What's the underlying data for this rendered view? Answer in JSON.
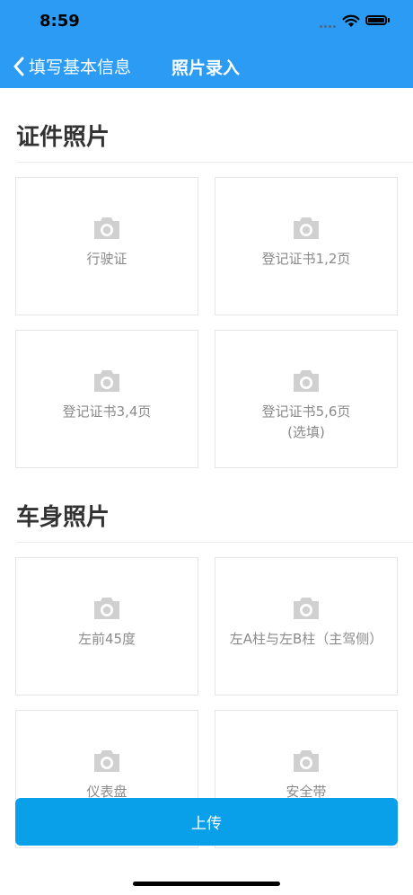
{
  "status_bar": {
    "time": "8:59"
  },
  "nav": {
    "back_label": "填写基本信息",
    "title": "照片录入"
  },
  "sections": [
    {
      "title": "证件照片",
      "tiles": [
        {
          "label": "行驶证",
          "label2": ""
        },
        {
          "label": "登记证书1,2页",
          "label2": ""
        },
        {
          "label": "登记证书3,4页",
          "label2": ""
        },
        {
          "label": "登记证书5,6页",
          "label2": "(选填)"
        }
      ]
    },
    {
      "title": "车身照片",
      "tiles": [
        {
          "label": "左前45度",
          "label2": ""
        },
        {
          "label": "左A柱与左B柱（主驾侧）",
          "label2": ""
        },
        {
          "label": "仪表盘",
          "label2": ""
        },
        {
          "label": "安全带",
          "label2": ""
        }
      ]
    }
  ],
  "actions": {
    "upload_label": "上传"
  },
  "colors": {
    "nav_bg": "#2b9bf4",
    "button_bg": "#0aa0e9",
    "icon": "#d0d0d0"
  }
}
